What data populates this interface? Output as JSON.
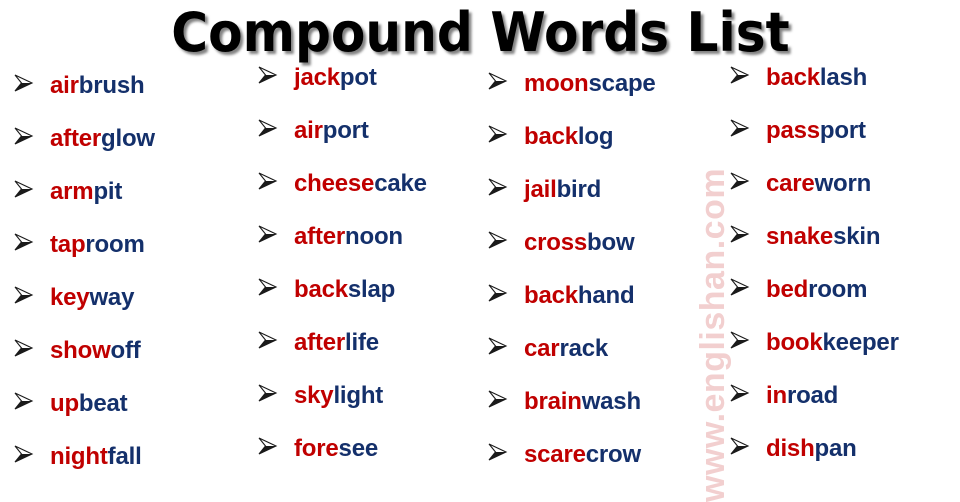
{
  "title": "Compound Words List",
  "watermark": "www.englishan.com",
  "bullet_icon": "arrowhead-bullet-icon",
  "colors": {
    "first_part": "#C00000",
    "second_part": "#14306B",
    "watermark": "#F2CFCF",
    "title": "#000000",
    "background": "#FFFFFF"
  },
  "columns": [
    {
      "id": "column-1",
      "words": [
        {
          "a": "air",
          "b": "brush"
        },
        {
          "a": "after",
          "b": "glow"
        },
        {
          "a": "arm",
          "b": "pit"
        },
        {
          "a": "tap",
          "b": "room"
        },
        {
          "a": "key",
          "b": "way"
        },
        {
          "a": "show",
          "b": "off"
        },
        {
          "a": "up",
          "b": "beat"
        },
        {
          "a": "night",
          "b": "fall"
        }
      ]
    },
    {
      "id": "column-2",
      "words": [
        {
          "a": "jack",
          "b": "pot"
        },
        {
          "a": "air",
          "b": "port"
        },
        {
          "a": "cheese",
          "b": "cake"
        },
        {
          "a": "after",
          "b": "noon"
        },
        {
          "a": "back",
          "b": "slap"
        },
        {
          "a": "after",
          "b": "life"
        },
        {
          "a": "sky",
          "b": "light"
        },
        {
          "a": "fore",
          "b": "see"
        }
      ]
    },
    {
      "id": "column-3",
      "words": [
        {
          "a": "moon",
          "b": "scape"
        },
        {
          "a": "back",
          "b": "log"
        },
        {
          "a": "jail",
          "b": "bird"
        },
        {
          "a": "cross",
          "b": "bow"
        },
        {
          "a": "back",
          "b": "hand"
        },
        {
          "a": "car",
          "b": "rack"
        },
        {
          "a": "brain",
          "b": "wash"
        },
        {
          "a": "scare",
          "b": "crow"
        }
      ]
    },
    {
      "id": "column-4",
      "words": [
        {
          "a": "back",
          "b": "lash"
        },
        {
          "a": "pass",
          "b": "port"
        },
        {
          "a": "care",
          "b": "worn"
        },
        {
          "a": "snake",
          "b": "skin"
        },
        {
          "a": "bed",
          "b": "room"
        },
        {
          "a": "book",
          "b": "keeper"
        },
        {
          "a": "in",
          "b": "road"
        },
        {
          "a": "dish",
          "b": "pan"
        }
      ]
    }
  ]
}
